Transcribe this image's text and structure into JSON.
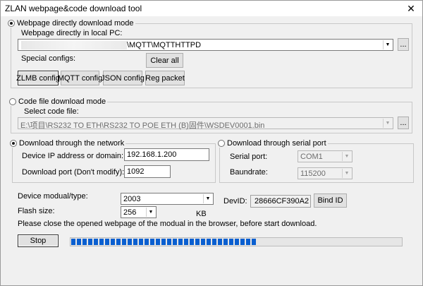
{
  "window": {
    "title": "ZLAN webpage&code download tool",
    "close_glyph": "✕"
  },
  "webpage_mode": {
    "label": "Webpage directly download mode",
    "checked": true,
    "pc_label": "Webpage directly in local PC:",
    "path_value": "\\MQTT\\MQTTHTTPD",
    "browse_label": "...",
    "special_label": "Special configs:",
    "clear_all_label": "Clear all",
    "buttons": [
      "ZLMB config",
      "MQTT config",
      "JSON config",
      "Reg packet"
    ]
  },
  "code_mode": {
    "label": "Code file download mode",
    "checked": false,
    "select_label": "Select code file:",
    "path_value": "E:\\项目\\RS232 TO ETH\\RS232 TO POE ETH (B)固件\\WSDEV0001.bin",
    "browse_label": "..."
  },
  "network": {
    "label": "Download through the network",
    "checked": true,
    "ip_label": "Device IP address or domain:",
    "ip_value": "192.168.1.200",
    "port_label": "Download port (Don't modify):",
    "port_value": "1092"
  },
  "serial": {
    "label": "Download through serial port",
    "checked": false,
    "port_label": "Serial port:",
    "port_value": "COM1",
    "baud_label": "Baundrate:",
    "baud_value": "115200"
  },
  "device": {
    "type_label": "Device modual/type:",
    "type_value": "2003",
    "flash_label": "Flash size:",
    "flash_value": "256",
    "flash_unit": "KB",
    "devid_label": "DevID:",
    "devid_value": "28666CF390A2",
    "bind_label": "Bind ID"
  },
  "notice": "Please close the opened webpage of the modual in the browser, before start download.",
  "stop_label": "Stop",
  "progress": {
    "fraction": 0.56,
    "color": "#0a5fd0"
  }
}
